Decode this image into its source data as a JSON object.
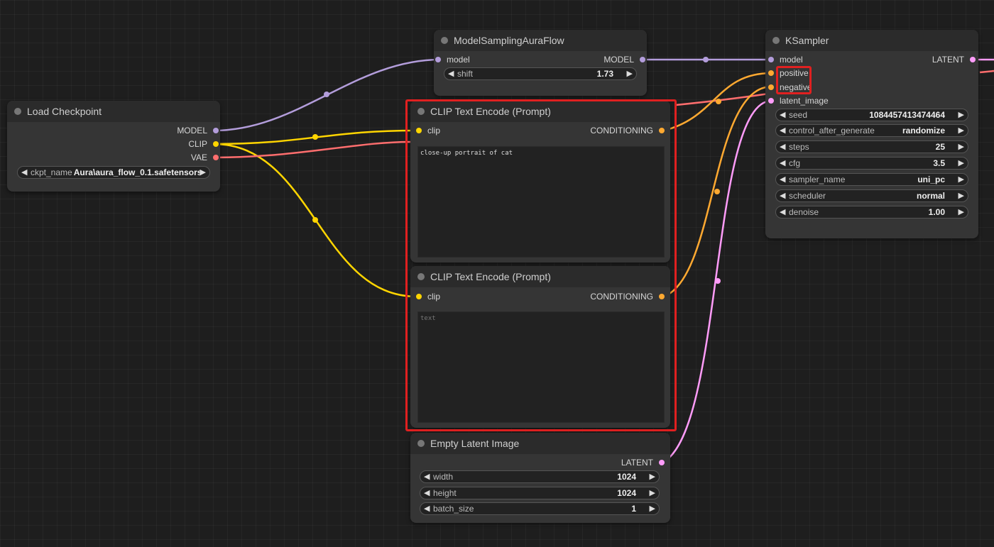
{
  "colors": {
    "model": "#b39ddb",
    "clip": "#ffd500",
    "vae": "#ff6e6e",
    "conditioning": "#ffa931",
    "latent": "#ff9cf9",
    "highlight": "#e02020"
  },
  "load_checkpoint": {
    "title": "Load Checkpoint",
    "outputs": [
      "MODEL",
      "CLIP",
      "VAE"
    ],
    "ckpt_label": "ckpt_name",
    "ckpt_value": "Aura\\aura_flow_0.1.safetensors"
  },
  "model_sampling": {
    "title": "ModelSamplingAuraFlow",
    "input": "model",
    "output": "MODEL",
    "shift_label": "shift",
    "shift_value": "1.73"
  },
  "clip_encode_pos": {
    "title": "CLIP Text Encode (Prompt)",
    "input": "clip",
    "output": "CONDITIONING",
    "text": "close-up portrait of cat"
  },
  "clip_encode_neg": {
    "title": "CLIP Text Encode (Prompt)",
    "input": "clip",
    "output": "CONDITIONING",
    "placeholder": "text"
  },
  "empty_latent": {
    "title": "Empty Latent Image",
    "output": "LATENT",
    "widgets": [
      {
        "label": "width",
        "value": "1024"
      },
      {
        "label": "height",
        "value": "1024"
      },
      {
        "label": "batch_size",
        "value": "1"
      }
    ]
  },
  "ksampler": {
    "title": "KSampler",
    "inputs": [
      "model",
      "positive",
      "negative",
      "latent_image"
    ],
    "output": "LATENT",
    "widgets": [
      {
        "label": "seed",
        "value": "1084457413474464"
      },
      {
        "label": "control_after_generate",
        "value": "randomize"
      },
      {
        "label": "steps",
        "value": "25"
      },
      {
        "label": "cfg",
        "value": "3.5"
      },
      {
        "label": "sampler_name",
        "value": "uni_pc"
      },
      {
        "label": "scheduler",
        "value": "normal"
      },
      {
        "label": "denoise",
        "value": "1.00"
      }
    ]
  }
}
